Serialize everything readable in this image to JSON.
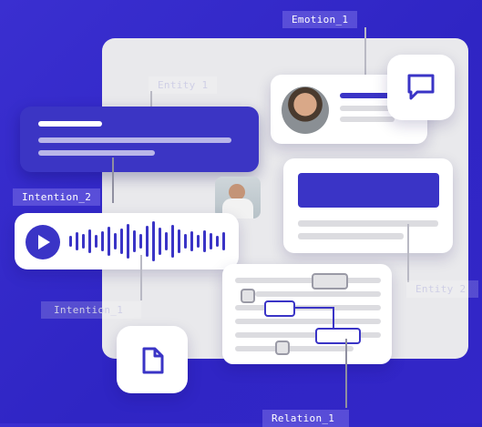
{
  "labels": {
    "emotion_1": "Emotion_1",
    "entity_1": "Entity 1",
    "intention_2": "Intention_2",
    "intention_1": "Intention_1",
    "entity_2": "Entity 2",
    "relation_1": "Relation_1"
  },
  "colors": {
    "background": "#3a2fd0",
    "accent": "#3a34c6",
    "panel": "#e9e9ec"
  },
  "icons": {
    "chat": "chat-bubble-icon",
    "document": "document-icon",
    "play": "play-icon"
  }
}
